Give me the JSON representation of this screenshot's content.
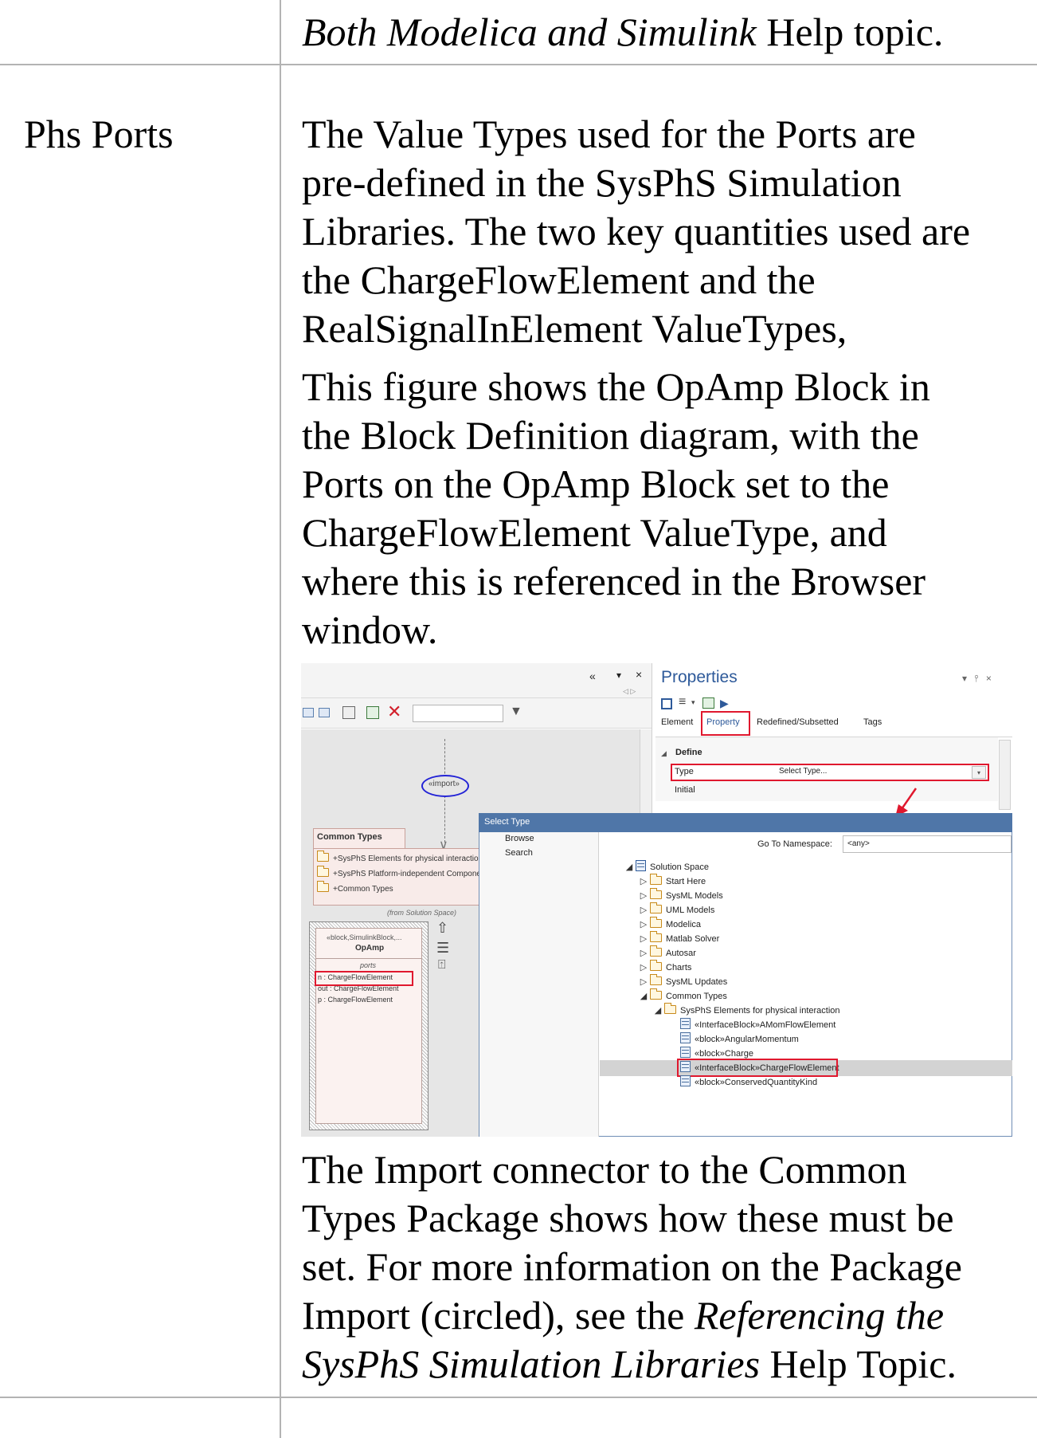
{
  "top_row": {
    "italic_text": "Both Modelica and Simulink",
    "trailing_text": " Help topic."
  },
  "row": {
    "label": "Phs Ports",
    "para1": [
      "The Value Types used for the Ports are",
      "pre-defined in the SysPhS Simulation",
      "Libraries. The two key quantities used are",
      "the ChargeFlowElement and the",
      "RealSignalInElement ValueTypes,"
    ],
    "para2": [
      "This figure shows the OpAmp Block in",
      "the Block Definition diagram, with the",
      "Ports on the OpAmp Block set to the",
      "ChargeFlowElement ValueType, and",
      "where this is referenced in the Browser",
      "window."
    ],
    "para3": {
      "line1": "The Import connector to the Common",
      "line2": "Types Package shows how these must be",
      "line3": "set. For more information on the Package",
      "line4_prefix": "Import (circled), see the ",
      "line4_italic": "Referencing the",
      "line5_italic": "SysPhS Simulation Libraries",
      "line5_suffix": " Help Topic."
    }
  },
  "screenshot": {
    "panel_controls": {
      "collapse": "«",
      "dropdown": "▾",
      "close": "×",
      "nav": "◁ ▷"
    },
    "properties": {
      "title": "Properties",
      "title_controls": "▾ ⫯ ×",
      "tabs": [
        "Element",
        "Property",
        "Redefined/Subsetted",
        "Tags"
      ],
      "section": "Define",
      "type_label": "Type",
      "type_value": "Select Type...",
      "initial_label": "Initial"
    },
    "diagram": {
      "import_label": "«import»",
      "package_name": "Common Types",
      "package_items": [
        "+SysPhS Elements for physical interaction",
        "+SysPhS Platform-independent Compone",
        "+Common Types"
      ],
      "from_note": "(from Solution Space)",
      "block_stereotype": "«block,SimulinkBlock,...",
      "block_name": "OpAmp",
      "compartment": "ports",
      "ports": [
        "n : ChargeFlowElement",
        "out : ChargeFlowElement",
        "p : ChargeFlowElement"
      ]
    },
    "dialog": {
      "title": "Select Type",
      "nav": [
        "Browse",
        "Search"
      ],
      "namespace_label": "Go To Namespace:",
      "namespace_value": "<any>",
      "tree": [
        "Solution Space",
        "Start Here",
        "SysML Models",
        "UML Models",
        "Modelica",
        "Matlab Solver",
        "Autosar",
        "Charts",
        "SysML Updates",
        "Common Types",
        "SysPhS Elements for physical interaction",
        "«InterfaceBlock»AMomFlowElement",
        "«block»AngularMomentum",
        "«block»Charge",
        "«InterfaceBlock»ChargeFlowElement",
        "«block»ConservedQuantityKind"
      ]
    },
    "colors": {
      "highlight": "#e0182e",
      "accent": "#2e5a9a",
      "dialog_title": "#4f76a8",
      "import_ellipse": "#2323d6"
    }
  }
}
